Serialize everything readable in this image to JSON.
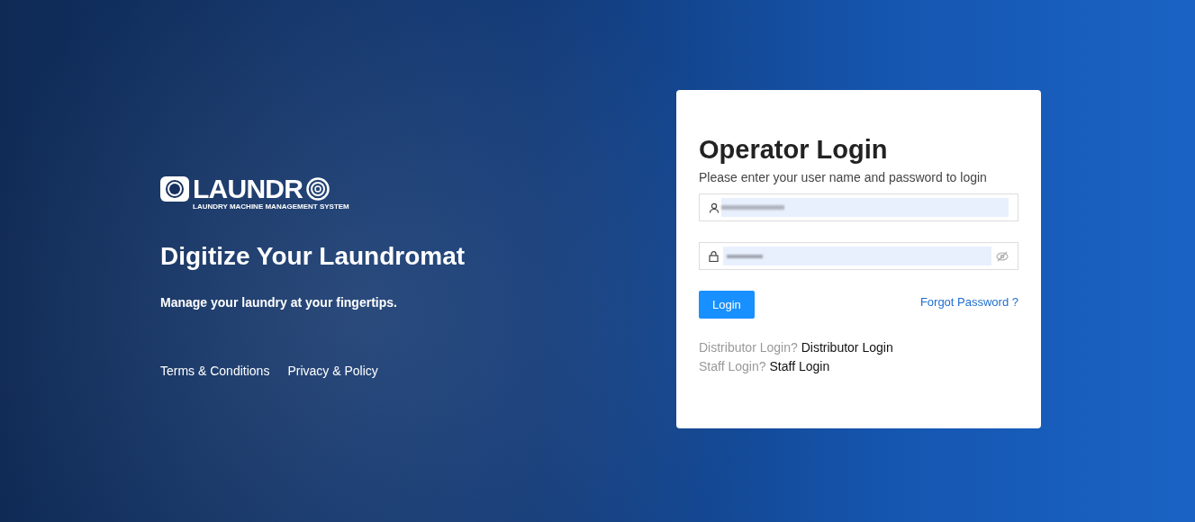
{
  "brand": {
    "logo_text": "LAUNDR",
    "logo_subtitle": "LAUNDRY MACHINE MANAGEMENT SYSTEM",
    "headline": "Digitize Your Laundromat",
    "tagline": "Manage your laundry at your fingertips.",
    "links": [
      "Terms & Conditions",
      "Privacy & Policy"
    ]
  },
  "login": {
    "title": "Operator Login",
    "subtitle": "Please enter your user name and password to login",
    "button": "Login",
    "forgot": "Forgot Password ?",
    "alt_logins": [
      {
        "prompt": "Distributor Login?",
        "link": "Distributor Login"
      },
      {
        "prompt": "Staff Login?",
        "link": "Staff Login"
      }
    ]
  }
}
